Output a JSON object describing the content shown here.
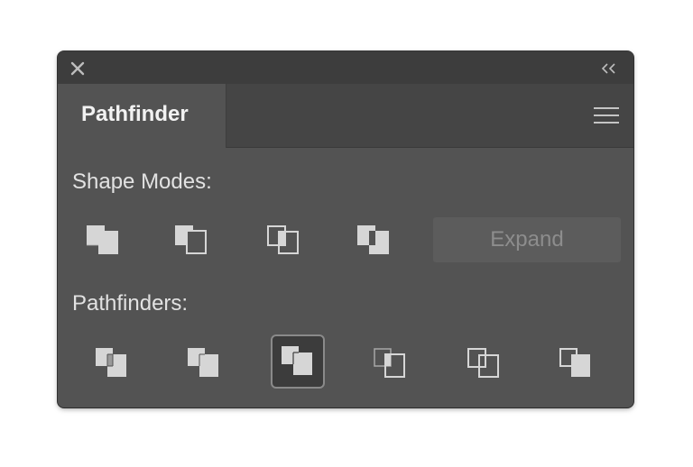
{
  "panel": {
    "tab_label": "Pathfinder",
    "close_icon": "close-icon",
    "collapse_icon": "double-chevron-left-icon",
    "menu_icon": "hamburger-menu-icon"
  },
  "shape_modes": {
    "label": "Shape Modes:",
    "buttons": [
      {
        "icon": "unite-icon"
      },
      {
        "icon": "minus-front-icon"
      },
      {
        "icon": "intersect-icon"
      },
      {
        "icon": "exclude-icon"
      }
    ],
    "expand_label": "Expand",
    "expand_enabled": false
  },
  "pathfinders": {
    "label": "Pathfinders:",
    "buttons": [
      {
        "icon": "divide-icon",
        "selected": false
      },
      {
        "icon": "trim-icon",
        "selected": false
      },
      {
        "icon": "merge-icon",
        "selected": true
      },
      {
        "icon": "crop-icon",
        "selected": false
      },
      {
        "icon": "outline-icon",
        "selected": false
      },
      {
        "icon": "minus-back-icon",
        "selected": false
      }
    ]
  },
  "colors": {
    "panel_bg": "#535353",
    "shape_fill": "#d6d6d6",
    "shape_stroke": "#d6d6d6"
  }
}
